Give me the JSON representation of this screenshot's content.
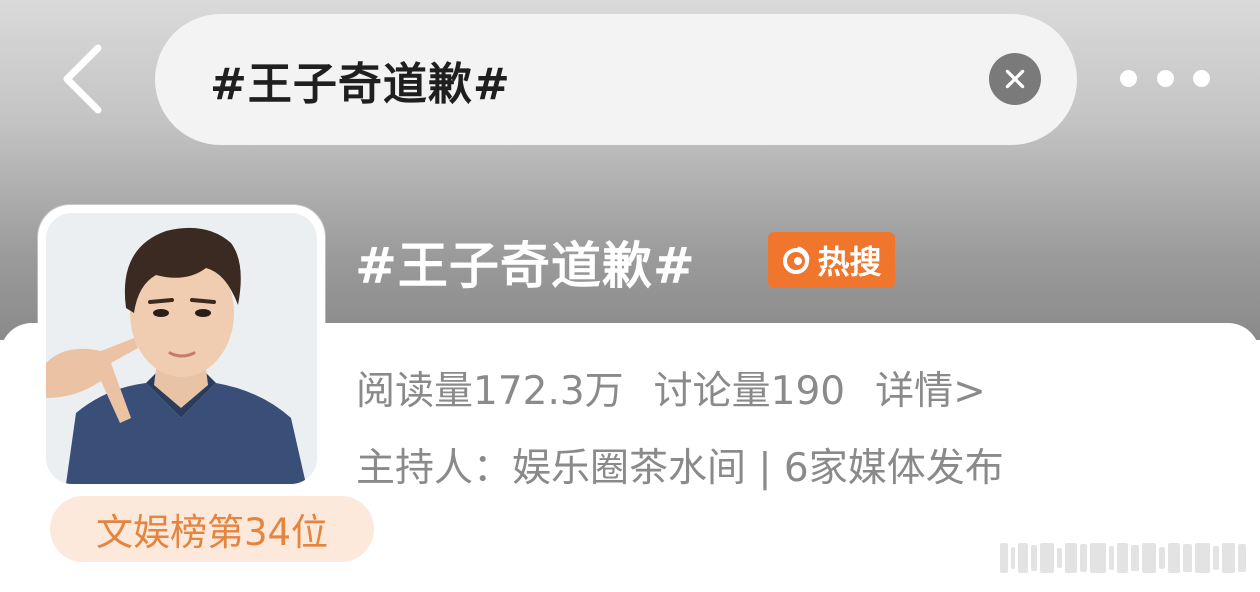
{
  "search": {
    "query": "#王子奇道歉#"
  },
  "topic": {
    "title": "#王子奇道歉#",
    "hot_badge": "热搜",
    "stats": {
      "reads": "阅读量172.3万",
      "discussions": "讨论量190",
      "details": "详情>"
    },
    "host": "主持人：娱乐圈茶水间 | 6家媒体发布",
    "rank": "文娱榜第34位"
  },
  "icons": {
    "back": "chevron-left-icon",
    "clear": "close-circle-icon",
    "more": "more-dots-icon",
    "hot": "fire-icon"
  },
  "colors": {
    "hot_badge_bg": "#f0762d",
    "rank_badge_bg": "#fde9dc",
    "rank_text": "#e5843e",
    "meta_text": "#8a8a8a"
  }
}
